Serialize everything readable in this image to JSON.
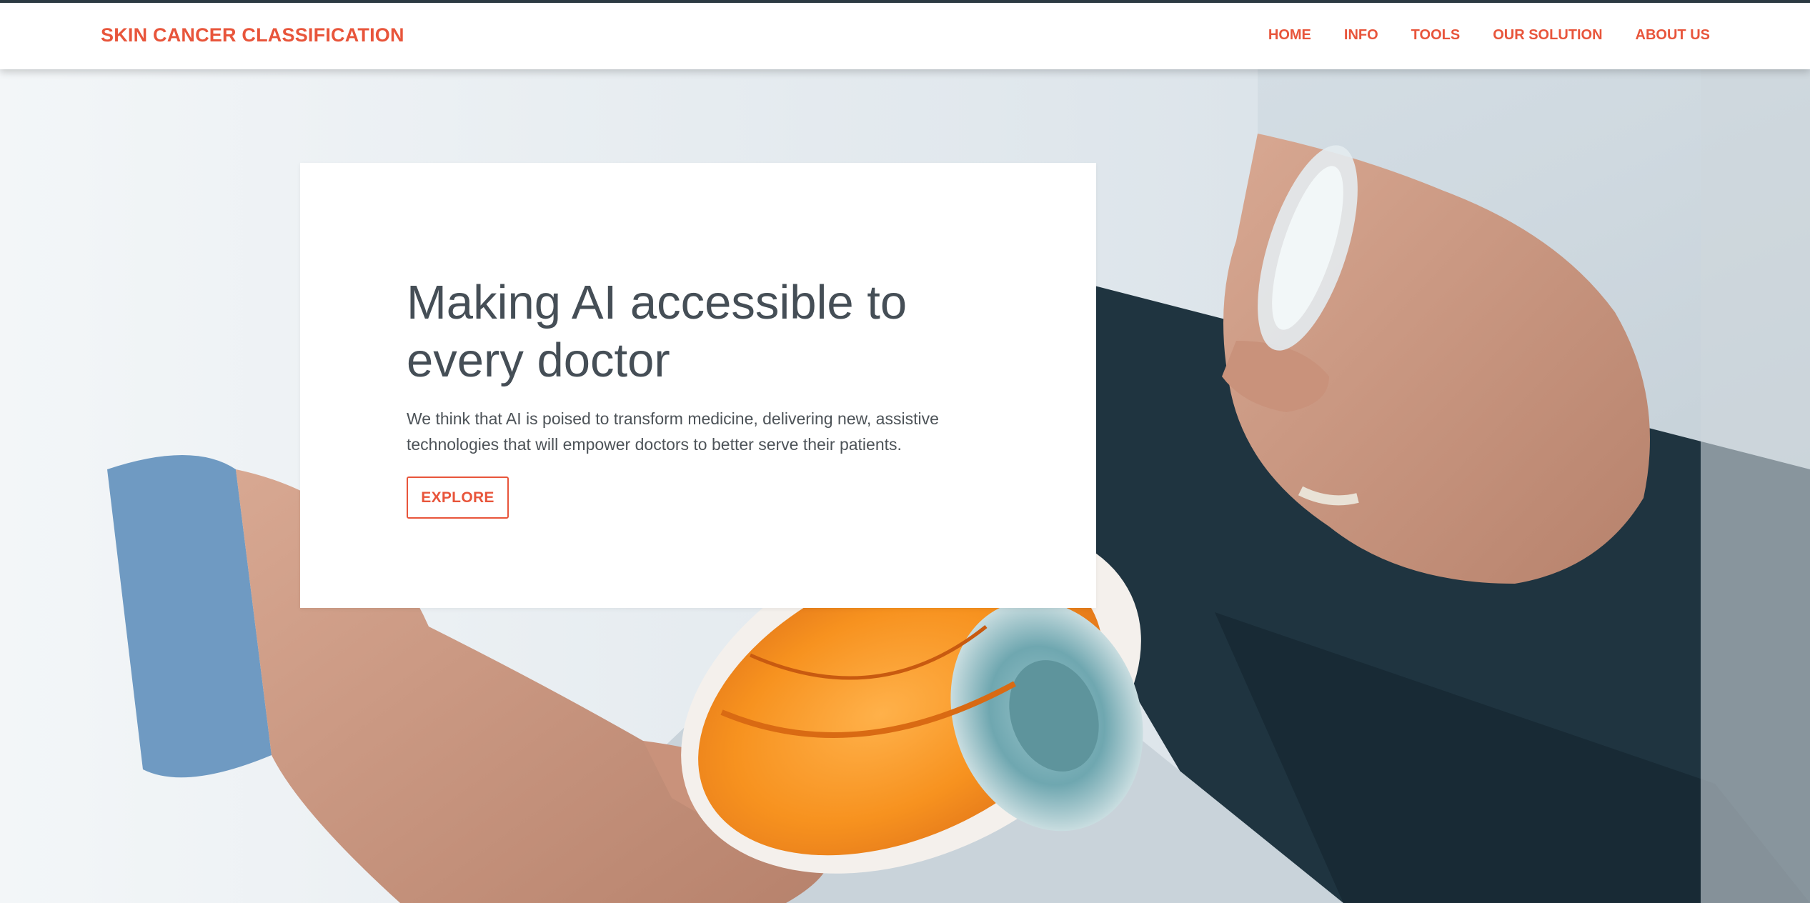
{
  "navbar": {
    "brand": "SKIN CANCER CLASSIFICATION",
    "links": [
      "HOME",
      "INFO",
      "TOOLS",
      "OUR SOLUTION",
      "ABOUT US"
    ]
  },
  "hero": {
    "title": "Making AI accessible to every doctor",
    "text": "We think that AI is poised to transform medicine, delivering new, assistive technologies that will empower doctors to better serve their patients.",
    "button_label": "EXPLORE",
    "background_image": "doctor-hands-holding-anatomical-eye-model"
  },
  "colors": {
    "accent": "#e8553b",
    "title": "#454e56",
    "body_text": "#4d5358",
    "navbar_bg": "#ffffff"
  }
}
